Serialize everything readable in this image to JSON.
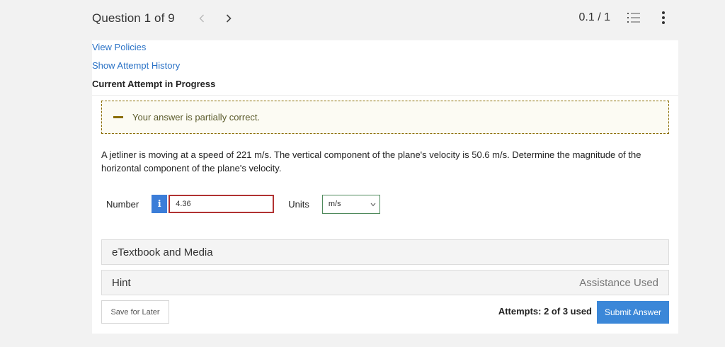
{
  "header": {
    "question_title": "Question 1 of 9",
    "score": "0.1 / 1"
  },
  "links": {
    "view_policies": "View Policies",
    "show_history": "Show Attempt History"
  },
  "attempt_label": "Current Attempt in Progress",
  "feedback": {
    "text": "Your answer is partially correct."
  },
  "question_text": "A jetliner is moving at a speed of 221 m/s. The vertical component of the plane's velocity is 50.6 m/s. Determine the magnitude of the horizontal component of the plane's velocity.",
  "answer": {
    "number_label": "Number",
    "info_glyph": "i",
    "value": "4.36",
    "units_label": "Units",
    "units_selected": "m/s"
  },
  "accordions": {
    "etextbook": "eTextbook and Media",
    "hint": "Hint",
    "hint_status": "Assistance Used"
  },
  "footer": {
    "save_label": "Save for Later",
    "attempts": "Attempts: 2 of 3 used",
    "submit_label": "Submit Answer"
  },
  "icons": {
    "prev": "chevron-left-icon",
    "next": "chevron-right-icon",
    "list": "list-icon",
    "more": "more-vertical-icon",
    "feedback": "minus-icon",
    "dropdown": "chevron-down-icon"
  },
  "colors": {
    "link": "#2a72c6",
    "primary": "#3b87d8",
    "feedback_border": "#8a6d00",
    "input_error": "#b13232"
  }
}
